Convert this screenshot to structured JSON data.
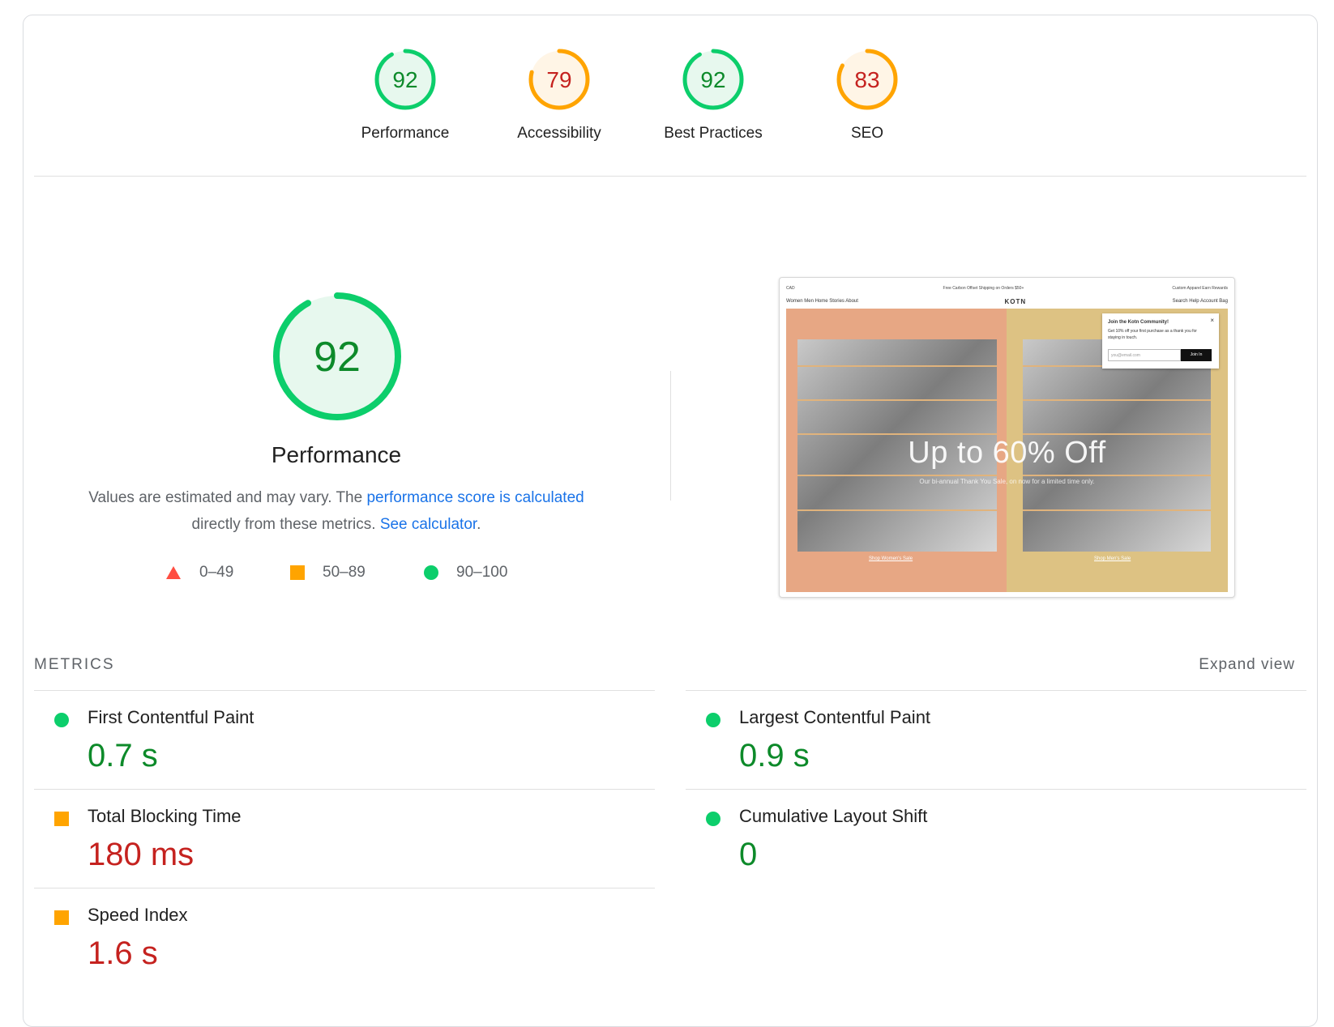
{
  "colors": {
    "pass": "#0cce6b",
    "average": "#ffa400",
    "fail": "#ff4e42",
    "pass_text": "#0d8a2a",
    "fail_text": "#c5221f"
  },
  "gauges": [
    {
      "label": "Performance",
      "score": 92,
      "rating": "pass"
    },
    {
      "label": "Accessibility",
      "score": 79,
      "rating": "average"
    },
    {
      "label": "Best Practices",
      "score": 92,
      "rating": "pass"
    },
    {
      "label": "SEO",
      "score": 83,
      "rating": "average"
    }
  ],
  "performance": {
    "score": "92",
    "title": "Performance",
    "desc_1": "Values are estimated and may vary. The ",
    "desc_link_1": "performance score is calculated",
    "desc_2": " directly from these metrics. ",
    "desc_link_2": "See calculator",
    "desc_3": "."
  },
  "legend": [
    {
      "icon": "triangle-icon",
      "range": "0–49"
    },
    {
      "icon": "square-icon",
      "range": "50–89"
    },
    {
      "icon": "circle-icon",
      "range": "90–100"
    }
  ],
  "screenshot": {
    "top_left": "CAD",
    "top_center": "Free Carbon Offset Shipping on Orders $50+",
    "top_right": "Custom Apparel   Earn Rewards",
    "nav_left": "Women   Men   Home   Stories   About",
    "brand": "KOTN",
    "nav_right": "Search   Help   Account   Bag",
    "headline": "Up to 60% Off",
    "subline": "Our bi-annual Thank You Sale, on now for a limited time only.",
    "shop_women": "Shop Women's Sale",
    "shop_men": "Shop Men's Sale",
    "popup_title": "Join the Kotn Community!",
    "popup_close": "×",
    "popup_text": "Get 10% off your first purchase as a thank you for staying in touch.",
    "popup_placeholder": "you@email.com",
    "popup_button": "Join In"
  },
  "metrics": {
    "heading": "METRICS",
    "expand_label": "Expand view",
    "items": [
      {
        "name": "First Contentful Paint",
        "value": "0.7 s",
        "rating": "pass"
      },
      {
        "name": "Largest Contentful Paint",
        "value": "0.9 s",
        "rating": "pass"
      },
      {
        "name": "Total Blocking Time",
        "value": "180 ms",
        "rating": "average"
      },
      {
        "name": "Cumulative Layout Shift",
        "value": "0",
        "rating": "pass"
      },
      {
        "name": "Speed Index",
        "value": "1.6 s",
        "rating": "average"
      }
    ]
  }
}
